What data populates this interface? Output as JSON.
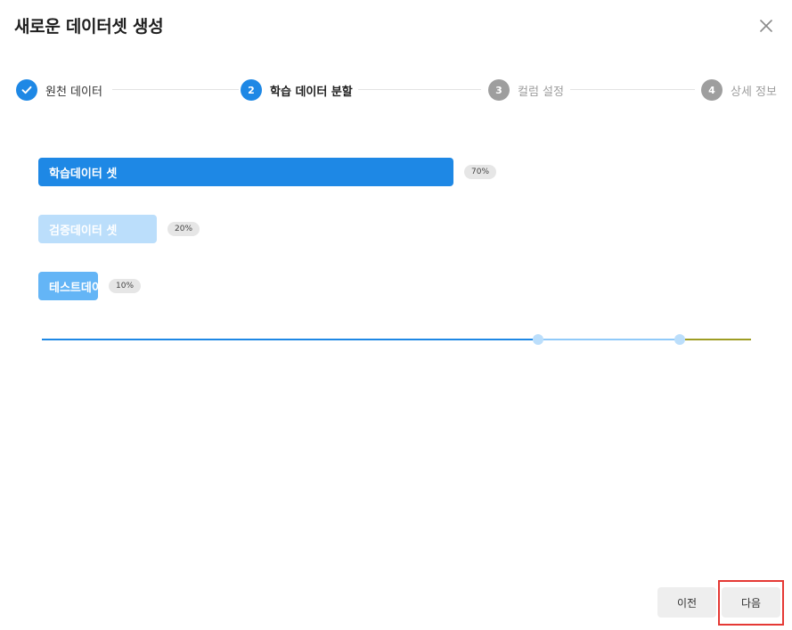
{
  "dialog": {
    "title": "새로운 데이터셋 생성",
    "close_icon": "close-icon"
  },
  "stepper": {
    "steps": [
      {
        "number": "1",
        "label": "원천 데이터",
        "state": "done",
        "icon": "check-icon"
      },
      {
        "number": "2",
        "label": "학습 데이터 분할",
        "state": "active"
      },
      {
        "number": "3",
        "label": "컬럼 설정",
        "state": "pending"
      },
      {
        "number": "4",
        "label": "상세 정보",
        "state": "pending"
      }
    ]
  },
  "split": {
    "items": [
      {
        "label": "학습데이터 셋",
        "percent_label": "70%",
        "percent": 70,
        "color": "#1e88e5",
        "text_color": "#ffffff"
      },
      {
        "label": "검증데이터 셋",
        "percent_label": "20%",
        "percent": 20,
        "color": "#bbdefb",
        "text_color": "#ffffff"
      },
      {
        "label": "테스트데이터 셋",
        "percent_label": "10%",
        "percent": 10,
        "color": "#64b5f6",
        "text_color": "#ffffff"
      }
    ],
    "slider": {
      "thumb_positions": [
        70,
        90
      ],
      "segment_colors": [
        "#1e88e5",
        "#90caf9",
        "#9e9d24"
      ]
    }
  },
  "footer": {
    "prev_label": "이전",
    "next_label": "다음",
    "highlight_color": "#e53935"
  }
}
